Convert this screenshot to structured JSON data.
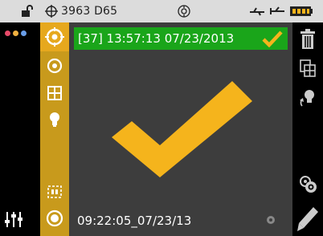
{
  "status_bar": {
    "device_id": "3963 D65",
    "icons": [
      "lock-open-icon",
      "target-small-icon",
      "sensor-icon",
      "usb-icon",
      "usb-plug-icon",
      "battery-icon"
    ]
  },
  "left_strip": {
    "dot_colors": [
      "#e84a6a",
      "#f0b040",
      "#6a9ee8"
    ],
    "sliders_icon": "sliders-icon"
  },
  "toolbar": {
    "items": [
      "target-icon",
      "target-icon",
      "grid-icon",
      "bulb-icon",
      "crop-icon",
      "record-icon"
    ]
  },
  "result": {
    "text": "[37] 13:57:13 07/23/2013",
    "status": "pass",
    "bar_color": "#1aa51a",
    "check_color": "#f5b41c"
  },
  "footer": {
    "timestamp": "09:22:05_07/23/13"
  },
  "right_strip": {
    "items": [
      "trash-icon",
      "copy-icon",
      "bulb-arrow-icon",
      "target-settings-icon",
      "pencil-icon"
    ]
  },
  "colors": {
    "accent": "#c89a1c",
    "accent_active": "#e6a81e",
    "main_bg": "#3d3d3d"
  }
}
